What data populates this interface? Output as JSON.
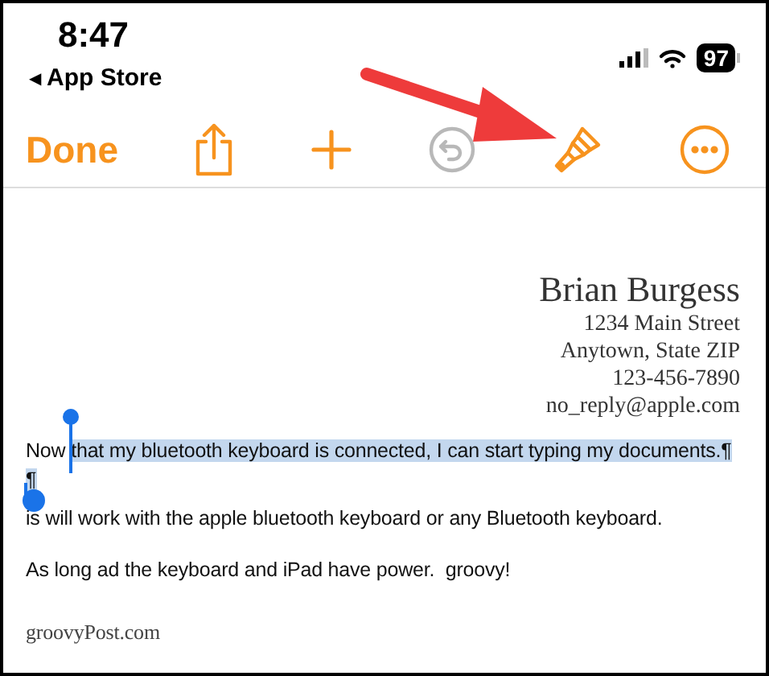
{
  "status_bar": {
    "time": "8:47",
    "back_arrow": "◀",
    "back_label": "App Store",
    "battery": "97"
  },
  "toolbar": {
    "done": "Done",
    "buttons": [
      {
        "kind": "share",
        "disabled": false
      },
      {
        "kind": "add",
        "disabled": false
      },
      {
        "kind": "undo",
        "disabled": true
      },
      {
        "kind": "brush",
        "disabled": false
      },
      {
        "kind": "more",
        "disabled": false
      }
    ]
  },
  "document": {
    "letterhead": [
      "Brian Burgess",
      "1234 Main Street",
      "Anytown, State ZIP",
      "123-456-7890",
      "no_reply@apple.com"
    ],
    "paragraphs": [
      {
        "segments": [
          {
            "text": "Now ",
            "selected": false
          },
          {
            "text": "that my bluetooth keyboard is connected, I can start typing my documents.¶",
            "selected": true
          }
        ]
      },
      {
        "segments": [
          {
            "text": "¶",
            "selected": true
          }
        ]
      },
      {
        "segments": [
          {
            "text": "is will work with the apple bluetooth keyboard or any Bluetooth keyboard.",
            "selected": false
          }
        ]
      },
      {
        "segments": [
          {
            "text": "As long ad the keyboard and iPad have power.  groovy!",
            "selected": false
          }
        ]
      }
    ],
    "footer": "groovyPost.com"
  }
}
